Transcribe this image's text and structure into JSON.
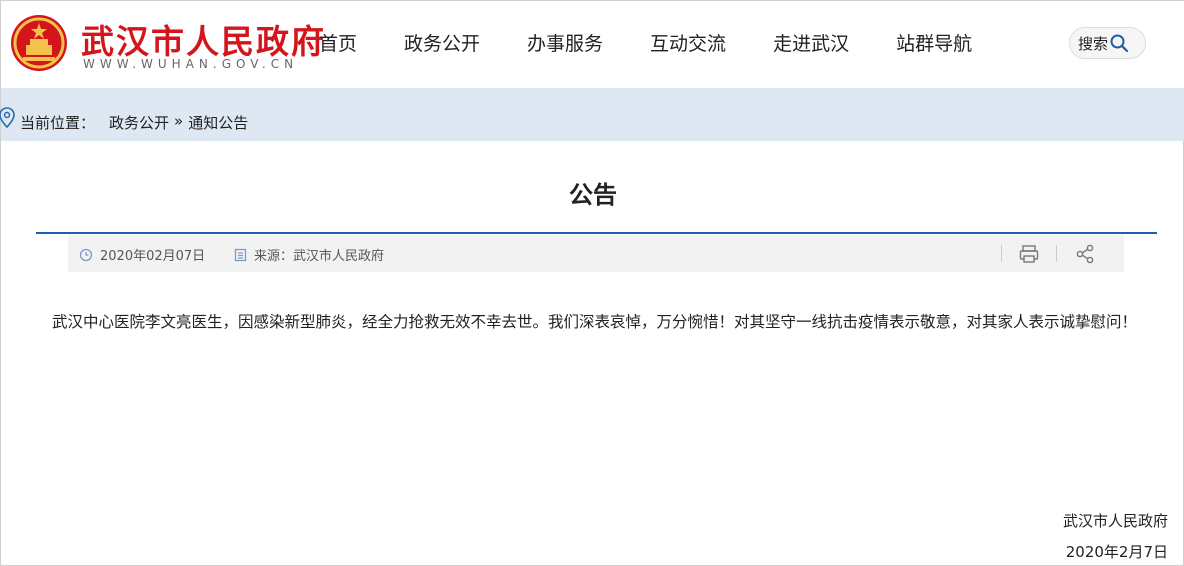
{
  "header": {
    "site_title": "武汉市人民政府",
    "site_url": "WWW.WUHAN.GOV.CN",
    "emblem_icon": "national-emblem-icon",
    "brand_color": "#d4161c",
    "nav": [
      "首页",
      "政务公开",
      "办事服务",
      "互动交流",
      "走进武汉",
      "站群导航"
    ],
    "search_label": "搜索"
  },
  "breadcrumb": {
    "prefix": "当前位置：",
    "items": [
      "政务公开",
      "通知公告"
    ],
    "separator": "»"
  },
  "article": {
    "title": "公告",
    "date": "2020年02月07日",
    "source": "来源：武汉市人民政府",
    "body": "武汉中心医院李文亮医生，因感染新型肺炎，经全力抢救无效不幸去世。我们深表哀悼，万分惋惜！对其坚守一线抗击疫情表示敬意，对其家人表示诚挚慰问！",
    "signature_org": "武汉市人民政府",
    "signature_date": "2020年2月7日"
  },
  "colors": {
    "accent": "#1f5fa8",
    "breadcrumb_bg": "#dde8f3",
    "meta_bg": "#f2f2f2"
  }
}
